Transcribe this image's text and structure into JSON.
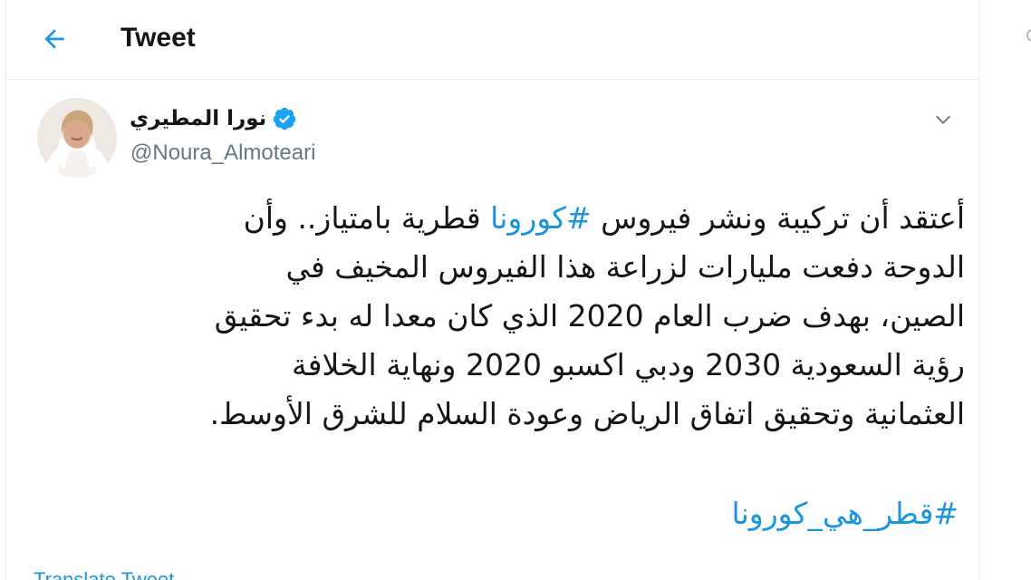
{
  "header": {
    "title": "Tweet",
    "back_icon": "arrow-left-icon"
  },
  "colors": {
    "accent": "#1b95e0",
    "text": "#14171a",
    "secondary": "#657786",
    "border": "#e6ecf0"
  },
  "tweet": {
    "author": {
      "name": "نورا المطيري",
      "handle": "@Noura_Almoteari",
      "verified": true
    },
    "lines": [
      {
        "before": "أعتقد أن تركيبة ونشر فيروس ",
        "hashtag": "#كورونا",
        "after": " قطرية بامتياز.. وأن"
      },
      {
        "text": "الدوحة دفعت مليارات لزراعة هذا الفيروس المخيف في"
      },
      {
        "text": "الصين، بهدف ضرب العام 2020 الذي كان معدا له بدء تحقيق"
      },
      {
        "text": "رؤية السعودية 2030 ودبي اكسبو 2020 ونهاية الخلافة"
      },
      {
        "text": "العثمانية وتحقيق اتفاق الرياض وعودة السلام للشرق الأوسط."
      }
    ],
    "trailing_hashtag": "#قطر_هي_كورونا",
    "translate_label": "Translate Tweet"
  }
}
